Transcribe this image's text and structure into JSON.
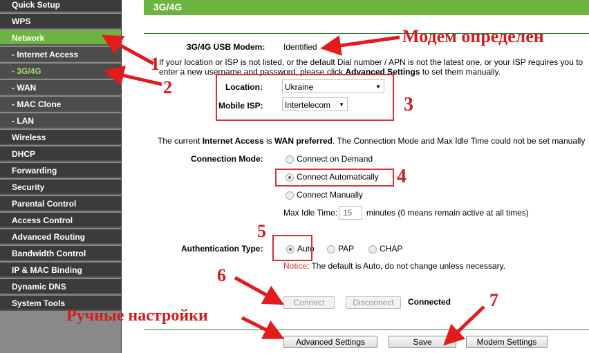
{
  "sidebar": {
    "items": [
      {
        "label": "Quick Setup"
      },
      {
        "label": "WPS"
      },
      {
        "label": "Network"
      },
      {
        "label": "- Internet Access"
      },
      {
        "label": "- 3G/4G"
      },
      {
        "label": "- WAN"
      },
      {
        "label": "- MAC Clone"
      },
      {
        "label": "- LAN"
      },
      {
        "label": "Wireless"
      },
      {
        "label": "DHCP"
      },
      {
        "label": "Forwarding"
      },
      {
        "label": "Security"
      },
      {
        "label": "Parental Control"
      },
      {
        "label": "Access Control"
      },
      {
        "label": "Advanced Routing"
      },
      {
        "label": "Bandwidth Control"
      },
      {
        "label": "IP & MAC Binding"
      },
      {
        "label": "Dynamic DNS"
      },
      {
        "label": "System Tools"
      }
    ]
  },
  "page": {
    "title": "3G/4G",
    "modem_label": "3G/4G USB Modem:",
    "modem_value": "Identified",
    "info1": "If your location or ISP is not listed, or the default Dial number / APN is not the latest one, or your ISP requires you to",
    "info2_a": "enter a new username and password, please click ",
    "info2_b": "Advanced Settings",
    "info2_c": " to set them manually.",
    "location_label": "Location:",
    "location_value": "Ukraine",
    "isp_label": "Mobile ISP:",
    "isp_value": "Intertelecom",
    "current_a": "The current ",
    "current_b": "Internet Access",
    "current_c": " is ",
    "current_d": "WAN preferred",
    "current_e": ". The Connection Mode and Max Idle Time could not be set manually",
    "conn_mode_label": "Connection Mode:",
    "conn_modes": [
      "Connect on Demand",
      "Connect Automatically",
      "Connect Manually"
    ],
    "idle_label": "Max Idle Time:",
    "idle_value": "15",
    "idle_hint": "minutes (0 means remain active at all times)",
    "auth_label": "Authentication Type:",
    "auth_options": [
      "Auto",
      "PAP",
      "CHAP"
    ],
    "notice_label": "Notice",
    "notice_text": ": The default is Auto, do not change unless necessary.",
    "connect": "Connect",
    "disconnect": "Disconnect",
    "status": "Connected",
    "advanced": "Advanced Settings",
    "save": "Save",
    "modem_settings": "Modem Settings"
  },
  "annotations": {
    "modem": "Модем определен",
    "manual": "Ручные настройки",
    "n1": "1",
    "n2": "2",
    "n3": "3",
    "n4": "4",
    "n5": "5",
    "n6": "6",
    "n7": "7",
    "color": "#d41c1c"
  }
}
